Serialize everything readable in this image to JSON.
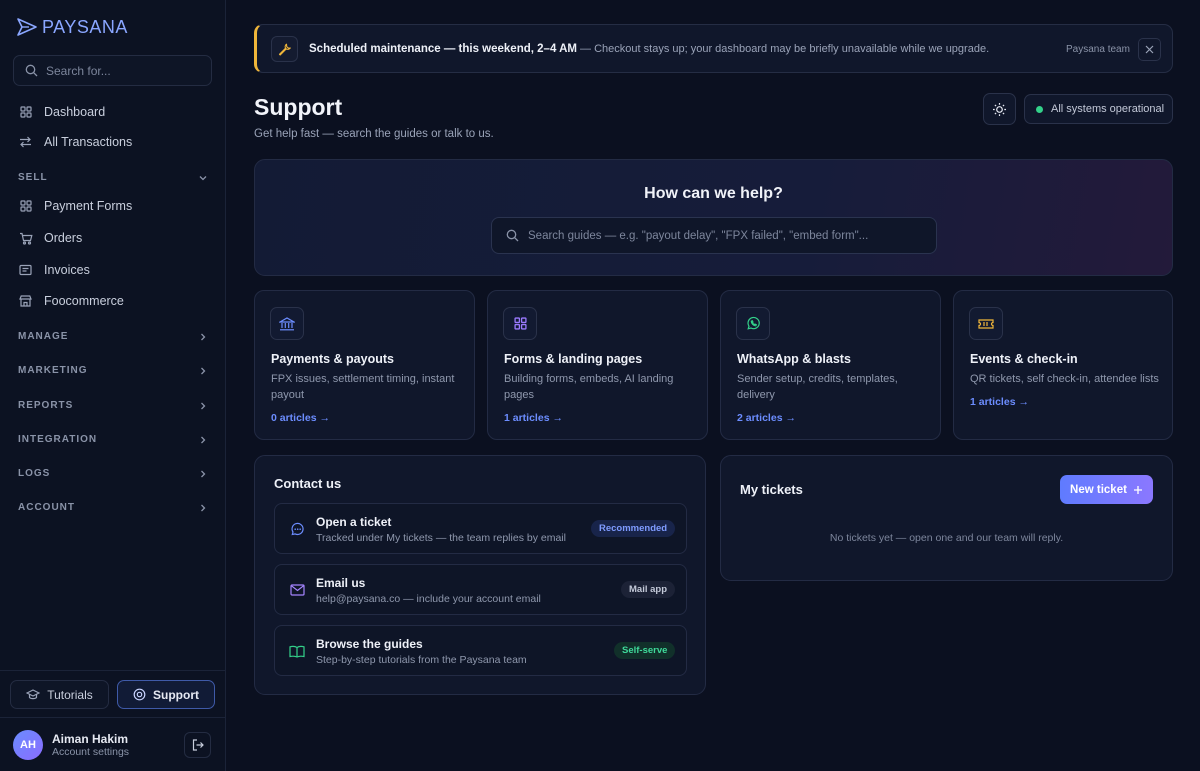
{
  "brand": {
    "name": "PAYSANA",
    "accent": "#8aa6ff"
  },
  "sidebar": {
    "search_placeholder": "Search for...",
    "top_items": [
      {
        "label": "Dashboard",
        "icon": "grid-icon"
      },
      {
        "label": "All Transactions",
        "icon": "swap-icon"
      }
    ],
    "sell": {
      "label": "SELL",
      "items": [
        {
          "label": "Payment Forms",
          "icon": "grid-icon"
        },
        {
          "label": "Orders",
          "icon": "cart-icon"
        },
        {
          "label": "Invoices",
          "icon": "invoice-icon"
        },
        {
          "label": "Foocommerce",
          "icon": "store-icon"
        }
      ]
    },
    "sections": [
      "MANAGE",
      "MARKETING",
      "REPORTS",
      "INTEGRATION",
      "LOGS",
      "ACCOUNT"
    ],
    "footer": {
      "tutorials_label": "Tutorials",
      "support_label": "Support",
      "user_initials": "AH",
      "user_name": "Aiman Hakim",
      "user_sub": "Account settings"
    }
  },
  "banner": {
    "title": "Scheduled maintenance — this weekend, 2–4 AM",
    "message": " — Checkout stays up; your dashboard may be briefly unavailable while we upgrade.",
    "team": "Paysana team",
    "accent": "#f0b63a"
  },
  "header": {
    "title": "Support",
    "subtitle": "Get help fast — search the guides or talk to us.",
    "status": "All systems operational",
    "status_color": "#33d18a"
  },
  "hero": {
    "title": "How can we help?",
    "search_placeholder": "Search guides — e.g. \"payout delay\", \"FPX failed\", \"embed form\"..."
  },
  "categories": [
    {
      "title": "Payments & payouts",
      "desc": "FPX issues, settlement timing, instant payout",
      "link": "0 articles →",
      "icon": "bank-icon",
      "color": "#6c8dff"
    },
    {
      "title": "Forms & landing pages",
      "desc": "Building forms, embeds, AI landing pages",
      "link": "1 articles →",
      "icon": "grid-icon",
      "color": "#9b7bff"
    },
    {
      "title": "WhatsApp & blasts",
      "desc": "Sender setup, credits, templates, delivery",
      "link": "2 articles →",
      "icon": "whatsapp-icon",
      "color": "#33d18a"
    },
    {
      "title": "Events & check-in",
      "desc": "QR tickets, self check-in, attendee lists",
      "link": "1 articles →",
      "icon": "ticket-icon",
      "color": "#f0b63a"
    }
  ],
  "contact": {
    "title": "Contact us",
    "rows": [
      {
        "title": "Open a ticket",
        "sub": "Tracked under My tickets — the team replies by email",
        "badge": "Recommended",
        "icon": "chat-icon"
      },
      {
        "title": "Email us",
        "sub": "help@paysana.co — include your account email",
        "badge": "Mail app",
        "icon": "mail-icon"
      },
      {
        "title": "Browse the guides",
        "sub": "Step-by-step tutorials from the Paysana team",
        "badge": "Self-serve",
        "icon": "book-icon"
      }
    ]
  },
  "tickets": {
    "title": "My tickets",
    "new_label": "New ticket",
    "empty": "No tickets yet — open one and our team will reply."
  }
}
